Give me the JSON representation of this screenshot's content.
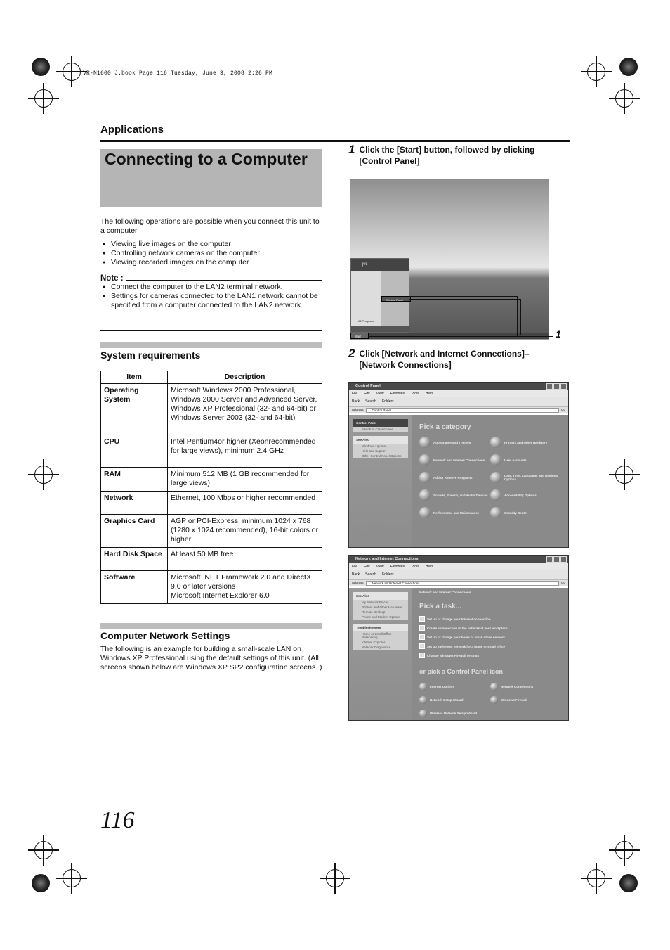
{
  "print_info": "VR-N1600_J.book  Page 116  Tuesday, June 3, 2008  2:26 PM",
  "section": "Applications",
  "title": "Connecting to a Computer",
  "intro": "The following operations are possible when you connect this unit to a computer.",
  "operations": [
    "Viewing live images on the computer",
    "Controlling network cameras on the computer",
    "Viewing recorded images on the computer"
  ],
  "note": {
    "label": "Note :",
    "items": [
      "Connect the computer to the LAN2 terminal network.",
      "Settings for cameras connected to the LAN1 network cannot be specified from a computer connected to the LAN2 network."
    ]
  },
  "sysreq": {
    "heading": "System requirements",
    "headers": [
      "Item",
      "Description"
    ],
    "rows": [
      {
        "item": "Operating System",
        "desc": "Microsoft Windows 2000 Professional, Windows 2000 Server and Advanced Server, Windows XP Professional (32- and 64-bit) or Windows Server 2003 (32- and 64-bit)"
      },
      {
        "item": "CPU",
        "desc": "Intel Pentium4or higher (Xeonrecommended for large views), minimum 2.4 GHz"
      },
      {
        "item": "RAM",
        "desc": "Minimum 512 MB (1 GB recommended for large views)"
      },
      {
        "item": "Network",
        "desc": "Ethernet, 100 Mbps or higher recommended"
      },
      {
        "item": "Graphics Card",
        "desc": "AGP or PCI-Express, minimum 1024 x 768 (1280 x 1024 recommended), 16-bit colors or higher"
      },
      {
        "item": "Hard Disk Space",
        "desc": "At least 50 MB free"
      },
      {
        "item": "Software",
        "desc": "Microsoft. NET Framework 2.0 and DirectX 9.0 or later versions\nMicrosoft Internet Explorer 6.0"
      }
    ]
  },
  "network_settings": {
    "heading": "Computer Network Settings",
    "text": "The following is an example for building a small-scale LAN on Windows XP Professional using the default settings of this unit. (All screens shown below are Windows XP SP2 configuration screens. )"
  },
  "steps": [
    {
      "num": "1",
      "text": "Click the [Start] button, followed by clicking [Control Panel]"
    },
    {
      "num": "2",
      "text": "Click [Network and Internet Connections]– [Network Connections]"
    }
  ],
  "callout": "1",
  "startmenu": {
    "user": "jvc",
    "control_panel": "Control Panel",
    "all_programs": "All Programs",
    "start": "start"
  },
  "win_menu": [
    "File",
    "Edit",
    "View",
    "Favorites",
    "Tools",
    "Help"
  ],
  "win_tools": [
    "Back",
    "Search",
    "Folders"
  ],
  "go": "Go",
  "address_label": "Address",
  "cp": {
    "title": "Control Panel",
    "address": "Control Panel",
    "side_title": "Control Panel",
    "switch": "Switch to Classic View",
    "see_also": "See Also",
    "see_items": [
      "Windows Update",
      "Help and Support",
      "Other Control Panel Options"
    ],
    "pick": "Pick a category",
    "categories": [
      "Appearance and Themes",
      "Printers and Other Hardware",
      "Network and Internet Connections",
      "User Accounts",
      "Add or Remove Programs",
      "Date, Time, Language, and Regional Options",
      "Sounds, Speech, and Audio Devices",
      "Accessibility Options",
      "Performance and Maintenance",
      "Security Center"
    ]
  },
  "nic": {
    "title": "Network and Internet Connections",
    "address": "Network and Internet Connections",
    "header": "Network and Internet Connections",
    "see_also": "See Also",
    "see_items": [
      "My Network Places",
      "Printers and Other Hardware",
      "Remote Desktop",
      "Phone and Modem Options"
    ],
    "troubleshooters": "Troubleshooters",
    "trouble_items": [
      "Home or Small Office Networking",
      "Internet Explorer",
      "Network Diagnostics"
    ],
    "pick": "Pick a task...",
    "tasks": [
      "Set up or change your Internet connection",
      "Create a connection to the network at your workplace",
      "Set up or change your home or small office network",
      "Set up a wireless network for a home or small office",
      "Change Windows Firewall settings"
    ],
    "or_pick": "or pick a Control Panel icon",
    "icons": [
      "Internet Options",
      "Network Connections",
      "Network Setup Wizard",
      "Windows Firewall",
      "Wireless Network Setup Wizard"
    ]
  },
  "page_number": "116"
}
